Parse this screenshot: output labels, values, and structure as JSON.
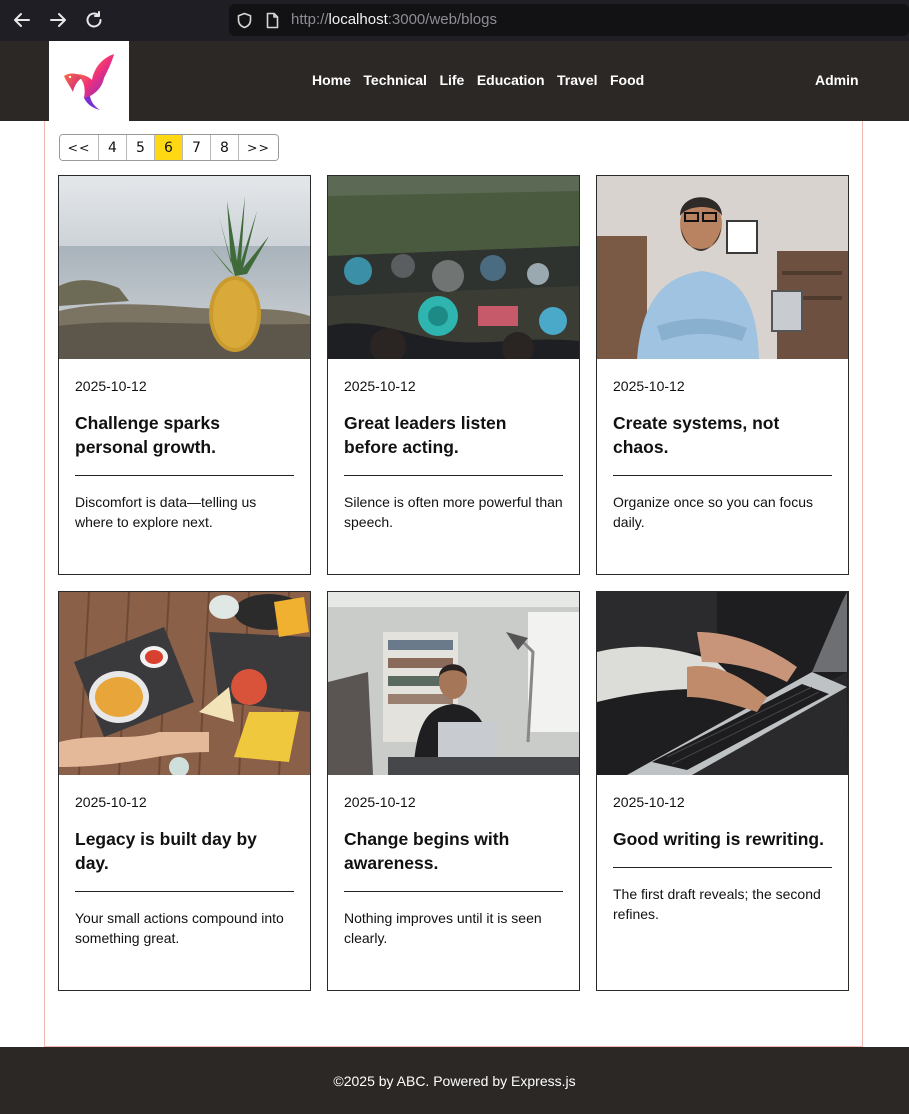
{
  "browser": {
    "url_scheme": "http://",
    "url_host": "localhost",
    "url_path": ":3000/web/blogs"
  },
  "header": {
    "nav": [
      "Home",
      "Technical",
      "Life",
      "Education",
      "Travel",
      "Food"
    ],
    "admin_label": "Admin"
  },
  "pagination": {
    "first": "<<",
    "pages": [
      "4",
      "5",
      "6",
      "7",
      "8"
    ],
    "active_page": "6",
    "last": ">>"
  },
  "posts": [
    {
      "date": "2025-10-12",
      "title": "Challenge sparks personal growth.",
      "excerpt": "Discomfort is data—telling us where to explore next."
    },
    {
      "date": "2025-10-12",
      "title": "Great leaders listen before acting.",
      "excerpt": "Silence is often more powerful than speech."
    },
    {
      "date": "2025-10-12",
      "title": "Create systems, not chaos.",
      "excerpt": "Organize once so you can focus daily."
    },
    {
      "date": "2025-10-12",
      "title": "Legacy is built day by day.",
      "excerpt": "Your small actions compound into something great."
    },
    {
      "date": "2025-10-12",
      "title": "Change begins with awareness.",
      "excerpt": "Nothing improves until it is seen clearly."
    },
    {
      "date": "2025-10-12",
      "title": "Good writing is rewriting.",
      "excerpt": "The first draft reveals; the second refines."
    }
  ],
  "footer": {
    "text": "©2025 by ABC. Powered by Express.js"
  },
  "colors": {
    "header_bg": "#2c2826",
    "active_page": "#ffd814"
  }
}
